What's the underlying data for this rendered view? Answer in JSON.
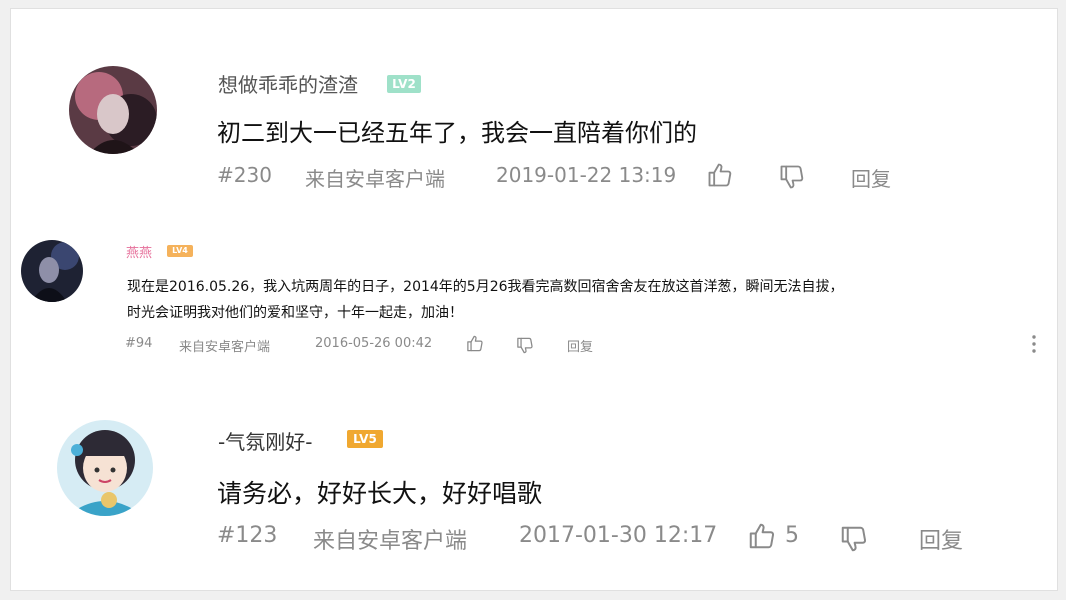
{
  "comments": [
    {
      "username": "想做乖乖的渣渣",
      "level": "LV2",
      "level_color": "#9fe1c9",
      "text": "初二到大一已经五年了，我会一直陪着你们的",
      "floor": "#230",
      "source": "来自安卓客户端",
      "timestamp": "2019-01-22 13:19",
      "reply_label": "回复"
    },
    {
      "username": "燕燕",
      "level": "LV4",
      "level_color": "#f5b25b",
      "text_lines": [
        "现在是2016.05.26，我入坑两周年的日子，2014年的5月26我看完高数回宿舍舍友在放这首洋葱，瞬间无法自拔，",
        "时光会证明我对他们的爱和坚守，十年一起走，加油！"
      ],
      "floor": "#94",
      "source": "来自安卓客户端",
      "timestamp": "2016-05-26 00:42",
      "reply_label": "回复",
      "more_icon": "more-vertical-icon"
    },
    {
      "username": "-气氛刚好-",
      "level": "LV5",
      "level_color": "#f0a830",
      "text": "请务必，好好长大，好好唱歌",
      "floor": "#123",
      "source": "来自安卓客户端",
      "timestamp": "2017-01-30 12:17",
      "likes": "5",
      "reply_label": "回复"
    }
  ],
  "icons": {
    "like": "thumbs-up-icon",
    "dislike": "thumbs-down-icon"
  }
}
